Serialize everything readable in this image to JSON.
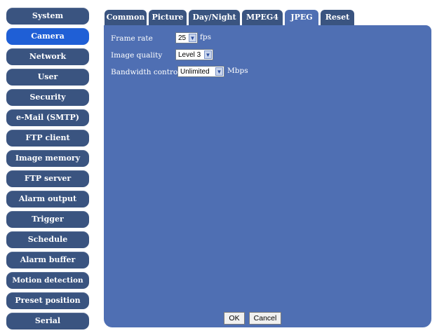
{
  "sidebar": {
    "items": [
      {
        "label": "System"
      },
      {
        "label": "Camera"
      },
      {
        "label": "Network"
      },
      {
        "label": "User"
      },
      {
        "label": "Security"
      },
      {
        "label": "e-Mail (SMTP)"
      },
      {
        "label": "FTP client"
      },
      {
        "label": "Image memory"
      },
      {
        "label": "FTP server"
      },
      {
        "label": "Alarm output"
      },
      {
        "label": "Trigger"
      },
      {
        "label": "Schedule"
      },
      {
        "label": "Alarm buffer"
      },
      {
        "label": "Motion detection"
      },
      {
        "label": "Preset position"
      },
      {
        "label": "Serial"
      }
    ],
    "active": "Camera"
  },
  "tabs": [
    {
      "label": "Common"
    },
    {
      "label": "Picture"
    },
    {
      "label": "Day/Night"
    },
    {
      "label": "MPEG4"
    },
    {
      "label": "JPEG"
    },
    {
      "label": "Reset"
    }
  ],
  "active_tab": "JPEG",
  "form": {
    "frame_rate": {
      "label": "Frame rate",
      "value": "25",
      "unit": "fps"
    },
    "image_quality": {
      "label": "Image quality",
      "value": "Level 3"
    },
    "bandwidth_control": {
      "label": "Bandwidth control",
      "value": "Unlimited",
      "unit": "Mbps"
    }
  },
  "buttons": {
    "ok": "OK",
    "cancel": "Cancel"
  },
  "icons": {
    "dropdown": "chevron-down-icon"
  },
  "colors": {
    "nav_bg": "#3a5480",
    "nav_active": "#1f5fd6",
    "panel_bg": "#4f6fb3"
  }
}
